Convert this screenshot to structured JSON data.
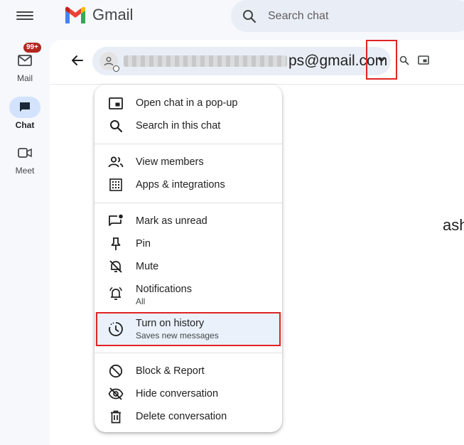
{
  "app": {
    "name": "Gmail"
  },
  "search": {
    "placeholder": "Search chat"
  },
  "rail": {
    "items": [
      {
        "label": "Mail",
        "badge": "99+"
      },
      {
        "label": "Chat"
      },
      {
        "label": "Meet"
      }
    ]
  },
  "chat": {
    "email_suffix": "ps@gmail.com",
    "peek_text": "ash"
  },
  "menu": {
    "items": [
      {
        "label": "Open chat in a pop-up"
      },
      {
        "label": "Search in this chat"
      },
      {
        "label": "View members"
      },
      {
        "label": "Apps & integrations"
      },
      {
        "label": "Mark as unread"
      },
      {
        "label": "Pin"
      },
      {
        "label": "Mute"
      },
      {
        "label": "Notifications",
        "sublabel": "All"
      },
      {
        "label": "Turn on history",
        "sublabel": "Saves new messages"
      },
      {
        "label": "Block & Report"
      },
      {
        "label": "Hide conversation"
      },
      {
        "label": "Delete conversation"
      }
    ]
  },
  "colors": {
    "highlight_border": "#e02424",
    "active_pill": "#d3e3fd",
    "badge": "#b3261e"
  }
}
